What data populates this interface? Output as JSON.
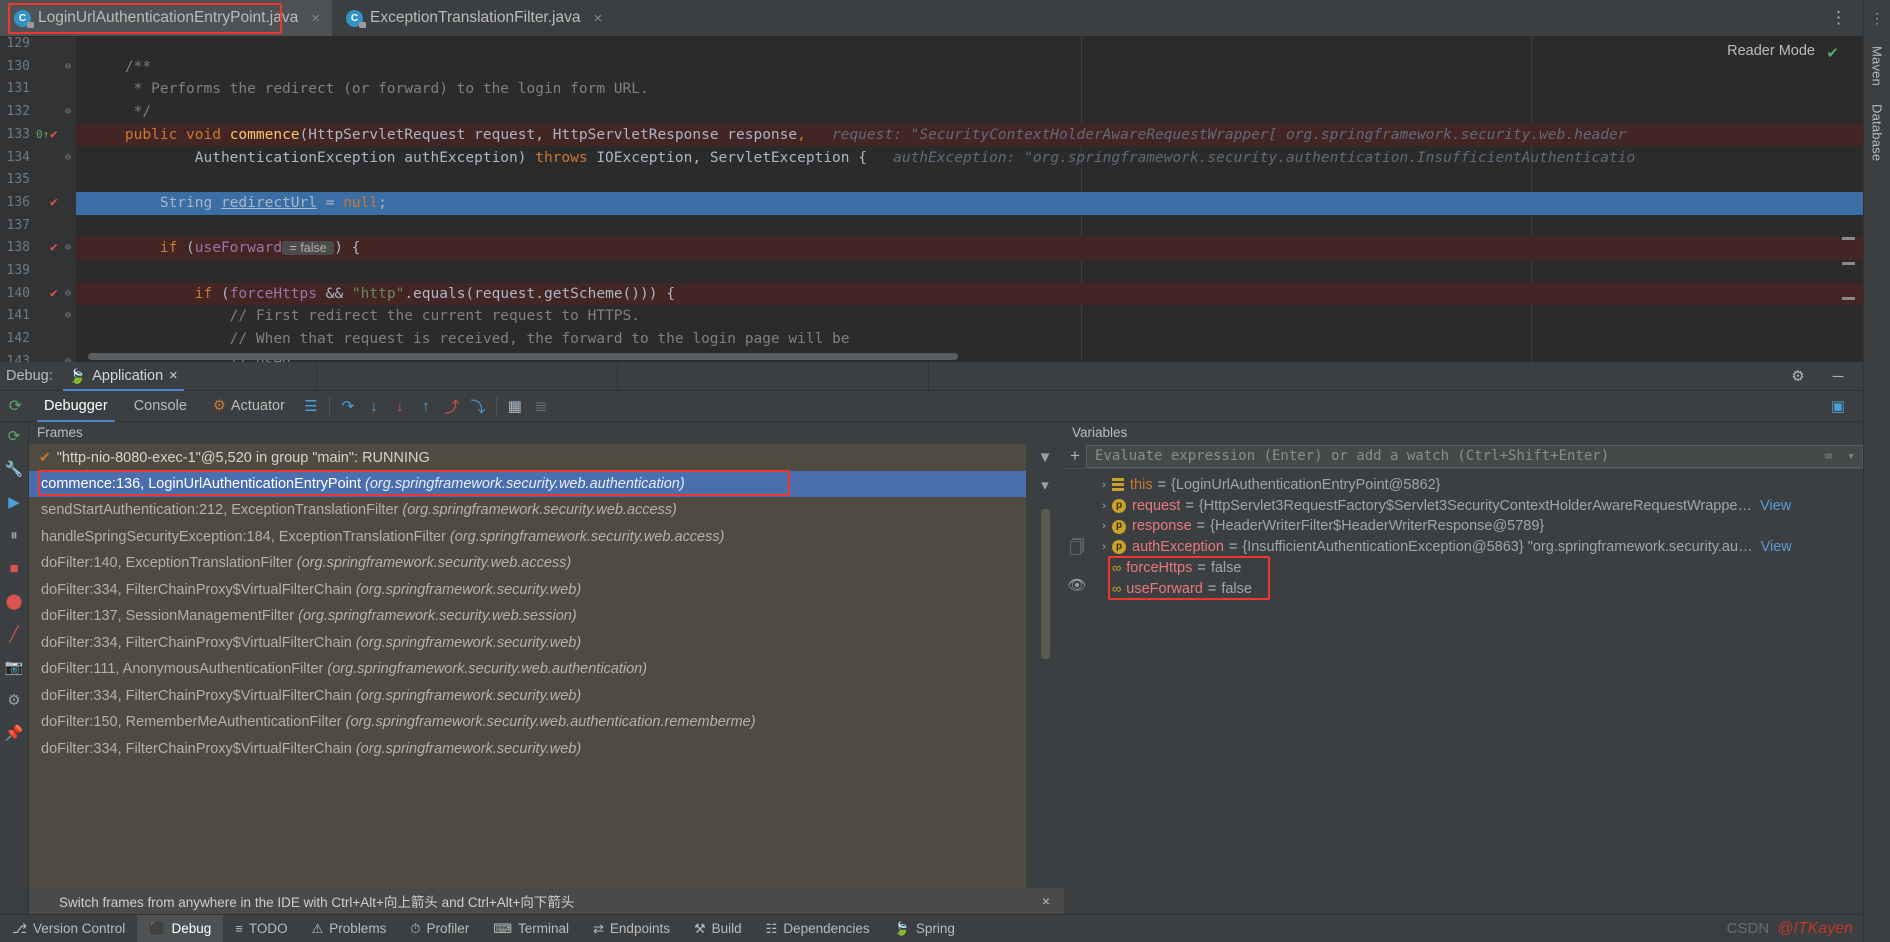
{
  "tabs": [
    {
      "label": "LoginUrlAuthenticationEntryPoint.java",
      "icon": "java-class-icon",
      "close": "×",
      "active": true
    },
    {
      "label": "ExceptionTranslationFilter.java",
      "icon": "java-class-icon",
      "close": "×",
      "active": false
    }
  ],
  "tabbar": {
    "kebab": "⋮"
  },
  "editor": {
    "reader_mode": "Reader Mode",
    "reader_check": "✔",
    "lines": [
      {
        "num": "129",
        "indent": 0,
        "state": "normal",
        "segments": []
      },
      {
        "num": "130",
        "indent": 0,
        "state": "normal",
        "fold": "⊖",
        "segments": [
          {
            "cls": "c",
            "t": "    /**"
          }
        ]
      },
      {
        "num": "131",
        "indent": 0,
        "state": "normal",
        "segments": [
          {
            "cls": "c",
            "t": "     * Performs the redirect (or forward) to the login form URL."
          }
        ]
      },
      {
        "num": "132",
        "indent": 0,
        "state": "normal",
        "fold": "⊖",
        "segments": [
          {
            "cls": "c",
            "t": "     */"
          }
        ]
      },
      {
        "num": "133",
        "indent": 0,
        "state": "bp",
        "gutter_icons": [
          "bookmark-green-icon",
          "breakpoint-check-icon"
        ],
        "segments": [
          {
            "cls": "k",
            "t": "    public void "
          },
          {
            "cls": "m",
            "t": "commence"
          },
          {
            "cls": "",
            "t": "(HttpServletRequest request, HttpServletResponse response"
          },
          {
            "cls": "k",
            "t": ","
          },
          {
            "cls": "hint",
            "t": "   request: \"SecurityContextHolderAwareRequestWrapper[ org.springframework.security.web.header"
          }
        ]
      },
      {
        "num": "134",
        "indent": 0,
        "state": "normal",
        "fold": "⊖",
        "segments": [
          {
            "cls": "",
            "t": "            AuthenticationException authException) "
          },
          {
            "cls": "k",
            "t": "throws "
          },
          {
            "cls": "",
            "t": "IOException, ServletException {"
          },
          {
            "cls": "hint",
            "t": "   authException: \"org.springframework.security.authentication.InsufficientAuthenticatio"
          }
        ]
      },
      {
        "num": "135",
        "indent": 0,
        "state": "normal",
        "segments": []
      },
      {
        "num": "136",
        "indent": 0,
        "state": "exec",
        "gutter_icons": [
          "breakpoint-check-icon"
        ],
        "segments": [
          {
            "cls": "",
            "t": "        String "
          },
          {
            "cls": "u",
            "t": "redirectUrl"
          },
          {
            "cls": "",
            "t": " = "
          },
          {
            "cls": "k",
            "t": "null"
          },
          {
            "cls": "",
            "t": ";"
          }
        ]
      },
      {
        "num": "137",
        "indent": 0,
        "state": "normal",
        "segments": []
      },
      {
        "num": "138",
        "indent": 0,
        "state": "bp",
        "gutter_icons": [
          "breakpoint-red-icon"
        ],
        "fold": "⊖",
        "segments": [
          {
            "cls": "k",
            "t": "        if "
          },
          {
            "cls": "",
            "t": "("
          },
          {
            "cls": "f",
            "t": "useForward"
          },
          {
            "cls": "inlay",
            "t": " = false "
          },
          {
            "cls": "",
            "t": ") {"
          }
        ]
      },
      {
        "num": "139",
        "indent": 0,
        "state": "normal",
        "segments": []
      },
      {
        "num": "140",
        "indent": 0,
        "state": "bp",
        "gutter_icons": [
          "breakpoint-red-icon"
        ],
        "fold": "⊖",
        "segments": [
          {
            "cls": "k",
            "t": "            if "
          },
          {
            "cls": "",
            "t": "("
          },
          {
            "cls": "f",
            "t": "forceHttps"
          },
          {
            "cls": "",
            "t": " && "
          },
          {
            "cls": "s",
            "t": "\"http\""
          },
          {
            "cls": "",
            "t": ".equals(request.getScheme())) {"
          }
        ]
      },
      {
        "num": "141",
        "indent": 0,
        "state": "normal",
        "fold": "⊖",
        "segments": [
          {
            "cls": "c",
            "t": "                // First redirect the current request to HTTPS."
          }
        ]
      },
      {
        "num": "142",
        "indent": 0,
        "state": "normal",
        "segments": [
          {
            "cls": "c",
            "t": "                // When that request is received, the forward to the login page will be"
          }
        ]
      },
      {
        "num": "143",
        "indent": 0,
        "state": "normal",
        "fold": "⊖",
        "segments": [
          {
            "cls": "c",
            "t": "                // used."
          }
        ]
      }
    ]
  },
  "debug": {
    "label": "Debug:",
    "tab": {
      "label": "Application",
      "icon": "spring-leaf-icon",
      "close": "×"
    },
    "header_icons": [
      "settings-gear-icon",
      "minimize-icon"
    ],
    "toolbar": {
      "rerun_icon": "rerun-icon",
      "tabs": [
        {
          "label": "Debugger",
          "active": true
        },
        {
          "label": "Console",
          "active": false
        },
        {
          "label": "Actuator",
          "active": false,
          "icon": "actuator-icon"
        }
      ],
      "buttons": [
        "layout-icon",
        "step-over-icon",
        "step-into-icon",
        "force-step-into-icon",
        "step-out-icon",
        "drop-frame-icon",
        "run-to-cursor-icon",
        "evaluate-icon",
        "mute-breakpoints-icon"
      ],
      "right_icon": "restore-layout-icon"
    },
    "left_rail_icons": [
      "rerun-icon",
      "settings-wrench-icon",
      "resume-icon",
      "pause-icon",
      "stop-icon",
      "view-breakpoints-icon",
      "mute-breakpoints-icon",
      "camera-icon",
      "settings-gear-icon",
      "pin-icon"
    ]
  },
  "frames": {
    "title": "Frames",
    "thread": {
      "check": "✔",
      "label": "\"http-nio-8080-exec-1\"@5,520 in group \"main\": RUNNING"
    },
    "filter_icon": "filter-icon",
    "dropdown_icon": "▾",
    "rows": [
      {
        "method": "commence:136, LoginUrlAuthenticationEntryPoint",
        "pkg": "(org.springframework.security.web.authentication)",
        "selected": true,
        "highlighted": true
      },
      {
        "method": "sendStartAuthentication:212, ExceptionTranslationFilter",
        "pkg": "(org.springframework.security.web.access)",
        "selected": false
      },
      {
        "method": "handleSpringSecurityException:184, ExceptionTranslationFilter",
        "pkg": "(org.springframework.security.web.access)",
        "selected": false
      },
      {
        "method": "doFilter:140, ExceptionTranslationFilter",
        "pkg": "(org.springframework.security.web.access)",
        "selected": false
      },
      {
        "method": "doFilter:334, FilterChainProxy$VirtualFilterChain",
        "pkg": "(org.springframework.security.web)",
        "selected": false
      },
      {
        "method": "doFilter:137, SessionManagementFilter",
        "pkg": "(org.springframework.security.web.session)",
        "selected": false
      },
      {
        "method": "doFilter:334, FilterChainProxy$VirtualFilterChain",
        "pkg": "(org.springframework.security.web)",
        "selected": false
      },
      {
        "method": "doFilter:111, AnonymousAuthenticationFilter",
        "pkg": "(org.springframework.security.web.authentication)",
        "selected": false
      },
      {
        "method": "doFilter:334, FilterChainProxy$VirtualFilterChain",
        "pkg": "(org.springframework.security.web)",
        "selected": false
      },
      {
        "method": "doFilter:150, RememberMeAuthenticationFilter",
        "pkg": "(org.springframework.security.web.authentication.rememberme)",
        "selected": false
      },
      {
        "method": "doFilter:334, FilterChainProxy$VirtualFilterChain",
        "pkg": "(org.springframework.security.web)",
        "selected": false
      }
    ],
    "footer": "Switch frames from anywhere in the IDE with Ctrl+Alt+向上箭头 and Ctrl+Alt+向下箭头",
    "footer_close": "×"
  },
  "variables": {
    "title": "Variables",
    "plus": "+",
    "eval_placeholder": "Evaluate expression (Enter) or add a watch (Ctrl+Shift+Enter)",
    "eval_value": "",
    "eval_icons": [
      "link-icon",
      "chevron-down-icon"
    ],
    "rows": [
      {
        "chev": "›",
        "badge": "this",
        "name": "this",
        "eq": "=",
        "value": "{LoginUrlAuthenticationEntryPoint@5862}",
        "link": "",
        "highlighted": false
      },
      {
        "chev": "›",
        "badge": "p",
        "name": "request",
        "eq": "=",
        "value": "{HttpServlet3RequestFactory$Servlet3SecurityContextHolderAwareRequestWrappe…",
        "link": "View",
        "highlighted": false
      },
      {
        "chev": "›",
        "badge": "p",
        "name": "response",
        "eq": "=",
        "value": "{HeaderWriterFilter$HeaderWriterResponse@5789}",
        "link": "",
        "highlighted": false
      },
      {
        "chev": "›",
        "badge": "p",
        "name": "authException",
        "eq": "=",
        "value": "{InsufficientAuthenticationException@5863} \"org.springframework.security.au…",
        "link": "View",
        "highlighted": false
      },
      {
        "chev": "",
        "badge": "oo",
        "name": "forceHttps",
        "eq": "=",
        "value": "false",
        "link": "",
        "highlighted": true
      },
      {
        "chev": "",
        "badge": "oo",
        "name": "useForward",
        "eq": "=",
        "value": "false",
        "link": "",
        "highlighted": true
      }
    ],
    "rail_icons": [
      "copy-icon",
      "eye-icon"
    ]
  },
  "statusbar": {
    "items": [
      {
        "label": "Version Control",
        "icon": "branch-icon",
        "active": false
      },
      {
        "label": "Debug",
        "icon": "debug-icon",
        "active": true
      },
      {
        "label": "TODO",
        "icon": "todo-icon",
        "active": false
      },
      {
        "label": "Problems",
        "icon": "problems-icon",
        "active": false
      },
      {
        "label": "Profiler",
        "icon": "profiler-icon",
        "active": false
      },
      {
        "label": "Terminal",
        "icon": "terminal-icon",
        "active": false
      },
      {
        "label": "Endpoints",
        "icon": "endpoints-icon",
        "active": false
      },
      {
        "label": "Build",
        "icon": "build-icon",
        "active": false
      },
      {
        "label": "Dependencies",
        "icon": "dependencies-icon",
        "active": false
      },
      {
        "label": "Spring",
        "icon": "spring-leaf-icon",
        "active": false
      }
    ],
    "watermark": "CSDN @ITKayen",
    "watermark_prefix": "CSDN ",
    "watermark_user": "@ITKayen"
  },
  "right_rail": {
    "items": [
      {
        "label": "Maven",
        "icon": "maven-icon"
      },
      {
        "label": "Database",
        "icon": "database-icon"
      }
    ]
  },
  "colors": {
    "accent_blue": "#4a6eae",
    "highlight_red": "#f2372f",
    "exec_line": "#3a6ea5",
    "breakpoint_line": "#432523"
  }
}
